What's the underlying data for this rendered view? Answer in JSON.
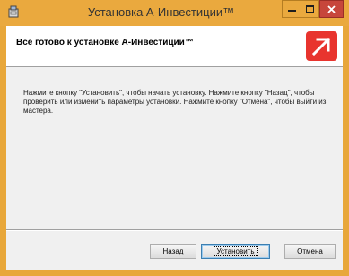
{
  "window": {
    "title": "Установка А-Инвестиции™",
    "accent": "#eaa93e",
    "close_color": "#c7463b"
  },
  "header": {
    "title": "Все готово к установке А-Инвестиции™",
    "logo_color": "#e8342e"
  },
  "body": {
    "text": "Нажмите кнопку \"Установить\", чтобы начать установку. Нажмите кнопку \"Назад\", чтобы проверить или изменить параметры установки. Нажмите кнопку \"Отмена\", чтобы выйти из мастера."
  },
  "buttons": {
    "back": "Назад",
    "install": "Установить",
    "cancel": "Отмена"
  },
  "icons": {
    "app": "installer-icon",
    "minimize": "minimize-icon",
    "maximize": "maximize-icon",
    "close": "close-icon",
    "logo": "alfa-logo-icon"
  }
}
